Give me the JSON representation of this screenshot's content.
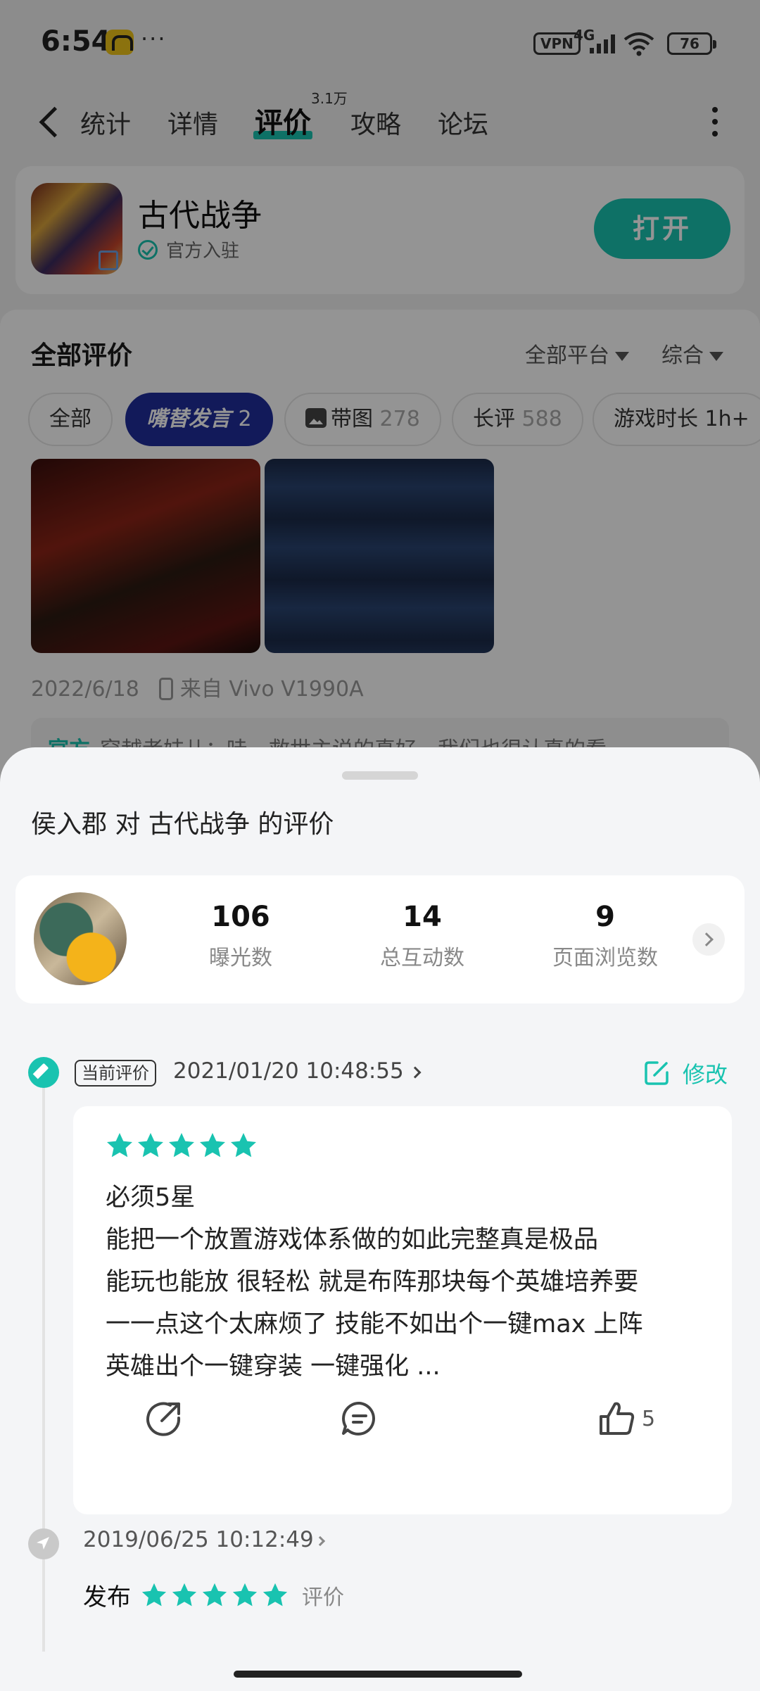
{
  "status_bar": {
    "time": "6:54",
    "dots": "···",
    "vpn": "VPN",
    "network": "4G",
    "battery": "76"
  },
  "nav": {
    "tabs": [
      {
        "label": "统计"
      },
      {
        "label": "详情"
      },
      {
        "label": "评价",
        "badge": "3.1万"
      },
      {
        "label": "攻略"
      },
      {
        "label": "论坛"
      }
    ]
  },
  "app": {
    "name": "古代战争",
    "official_label": "官方入驻",
    "open_button": "打开"
  },
  "reviews": {
    "title": "全部评价",
    "platform_filter": "全部平台",
    "sort_filter": "综合",
    "chips": [
      {
        "label": "全部",
        "count": ""
      },
      {
        "label": "嘴替发言",
        "count": "2"
      },
      {
        "label": "带图",
        "count": "278"
      },
      {
        "label": "长评",
        "count": "588"
      },
      {
        "label": "游戏时长 1h+",
        "count": ""
      }
    ],
    "post_date": "2022/6/18",
    "post_device": "来自 Vivo V1990A",
    "official_reply_tag": "官方",
    "official_reply_text": "穿越者妹儿：哇，救世主说的真好，我们也很认真的看"
  },
  "sheet": {
    "title": "侯入郡 对 古代战争 的评价",
    "stats": [
      {
        "value": "106",
        "label": "曝光数"
      },
      {
        "value": "14",
        "label": "总互动数"
      },
      {
        "value": "9",
        "label": "页面浏览数"
      }
    ],
    "current_tag": "当前评价",
    "current_time": "2021/01/20 10:48:55",
    "modify_label": "修改",
    "current_review": {
      "rating": 5,
      "text": "必须5星\n能把一个放置游戏体系做的如此完整真是极品\n能玩也能放 很轻松 就是布阵那块每个英雄培养要\n一一点这个太麻烦了 技能不如出个一键max 上阵\n英雄出个一键穿装 一键强化 ...",
      "likes": "5"
    },
    "history": {
      "time": "2019/06/25 10:12:49",
      "action": "发布",
      "rating": 5,
      "suffix": "评价"
    }
  },
  "colors": {
    "accent": "#19c3b0",
    "hot_chip": "#1f2d9c",
    "overlay": "rgba(0,0,0,0.42)"
  }
}
